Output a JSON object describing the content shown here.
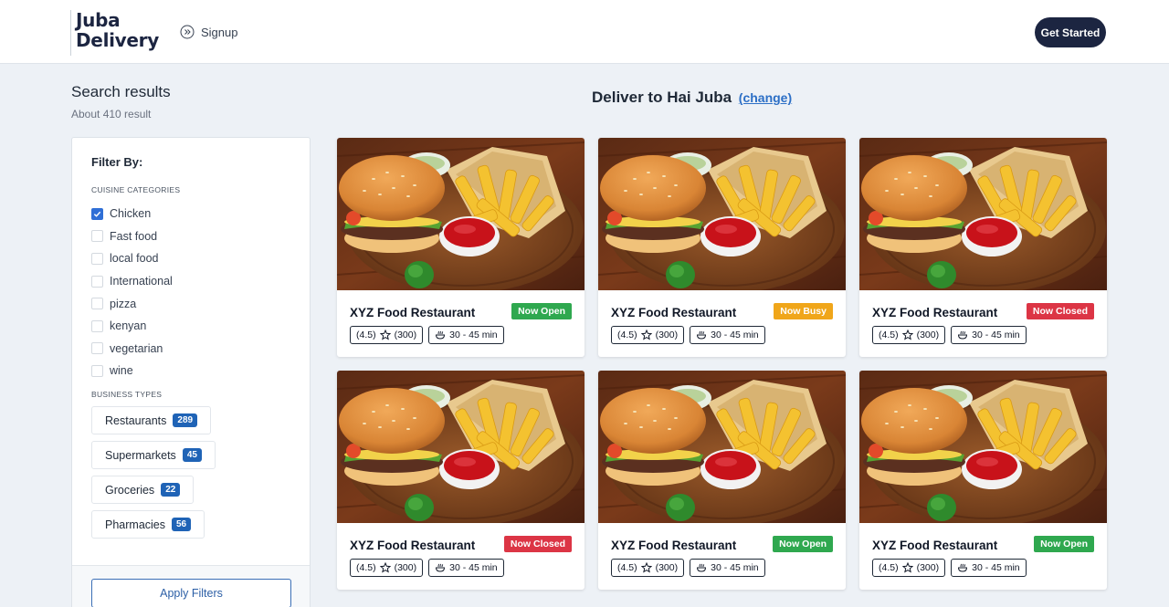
{
  "header": {
    "logo_line1": "Juba",
    "logo_line2": "Delivery",
    "signup_label": "Signup",
    "get_started_label": "Get Started"
  },
  "search": {
    "title": "Search results",
    "subtitle": "About 410 result"
  },
  "filters": {
    "title": "Filter By:",
    "cuisine_heading": "CUISINE CATEGORIES",
    "cuisines": [
      {
        "label": "Chicken",
        "checked": true
      },
      {
        "label": "Fast food",
        "checked": false
      },
      {
        "label": "local food",
        "checked": false
      },
      {
        "label": "International",
        "checked": false
      },
      {
        "label": "pizza",
        "checked": false
      },
      {
        "label": "kenyan",
        "checked": false
      },
      {
        "label": "vegetarian",
        "checked": false
      },
      {
        "label": "wine",
        "checked": false
      }
    ],
    "business_heading": "BUSINESS TYPES",
    "business_types": [
      {
        "label": "Restaurants",
        "count": "289"
      },
      {
        "label": "Supermarkets",
        "count": "45"
      },
      {
        "label": "Groceries",
        "count": "22"
      },
      {
        "label": "Pharmacies",
        "count": "56"
      }
    ],
    "apply_label": "Apply Filters"
  },
  "deliver": {
    "text": "Deliver to Hai Juba",
    "change_label": "(change)"
  },
  "restaurants": [
    {
      "name": "XYZ Food Restaurant",
      "status": "Now Open",
      "status_type": "open",
      "rating": "(4.5)",
      "reviews": "(300)",
      "time": "30 - 45 min"
    },
    {
      "name": "XYZ Food Restaurant",
      "status": "Now Busy",
      "status_type": "busy",
      "rating": "(4.5)",
      "reviews": "(300)",
      "time": "30 - 45 min"
    },
    {
      "name": "XYZ Food Restaurant",
      "status": "Now Closed",
      "status_type": "closed",
      "rating": "(4.5)",
      "reviews": "(300)",
      "time": "30 - 45 min"
    },
    {
      "name": "XYZ Food Restaurant",
      "status": "Now Closed",
      "status_type": "closed",
      "rating": "(4.5)",
      "reviews": "(300)",
      "time": "30 - 45 min"
    },
    {
      "name": "XYZ Food Restaurant",
      "status": "Now Open",
      "status_type": "open",
      "rating": "(4.5)",
      "reviews": "(300)",
      "time": "30 - 45 min"
    },
    {
      "name": "XYZ Food Restaurant",
      "status": "Now Open",
      "status_type": "open",
      "rating": "(4.5)",
      "reviews": "(300)",
      "time": "30 - 45 min"
    }
  ],
  "colors": {
    "brand_dark": "#1c2541",
    "accent_blue": "#2c6fc6",
    "open": "#2fa84f",
    "busy": "#f0a61a",
    "closed": "#dc3545"
  }
}
